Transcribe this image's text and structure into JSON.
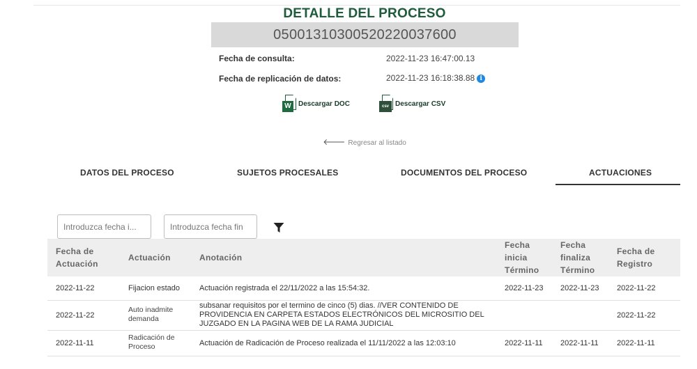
{
  "header": {
    "title": "DETALLE DEL PROCESO",
    "radicado": "05001310300520220037600",
    "consulta_label": "Fecha de consulta:",
    "consulta_value": "2022-11-23 16:47:00.13",
    "replicacion_label": "Fecha de replicación de datos:",
    "replicacion_value": "2022-11-23 16:18:38.88",
    "info_icon": "i"
  },
  "downloads": {
    "doc_badge": "W",
    "doc_label": "Descargar DOC",
    "csv_badge": "csv",
    "csv_label": "Descargar CSV"
  },
  "back_link": {
    "arrow": "🡐",
    "label": "Regresar al listado"
  },
  "tabs": [
    {
      "label": "DATOS DEL PROCESO"
    },
    {
      "label": "SUJETOS PROCESALES"
    },
    {
      "label": "DOCUMENTOS DEL PROCESO"
    },
    {
      "label": "ACTUACIONES",
      "active": true
    }
  ],
  "filters": {
    "start_placeholder": "Introduzca fecha i...",
    "end_placeholder": "Introduzca fecha fin",
    "filter_icon": "filter-icon"
  },
  "table": {
    "headers": {
      "fecha_actuacion": [
        "Fecha de",
        "Actuación"
      ],
      "actuacion": "Actuación",
      "anotacion": "Anotación",
      "fecha_inicia": [
        "Fecha",
        "inicia",
        "Término"
      ],
      "fecha_finaliza": [
        "Fecha",
        "finaliza",
        "Término"
      ],
      "fecha_registro": [
        "Fecha de",
        "Registro"
      ]
    },
    "rows": [
      {
        "fecha_actuacion": "2022-11-22",
        "actuacion": "Fijacion estado",
        "anotacion": "Actuación registrada el 22/11/2022 a las 15:54:32.",
        "fecha_inicia": "2022-11-23",
        "fecha_finaliza": "2022-11-23",
        "fecha_registro": "2022-11-22"
      },
      {
        "fecha_actuacion": "2022-11-22",
        "actuacion_lines": [
          "Auto inadmite",
          "demanda"
        ],
        "anotacion_lines": [
          "subsanar requisitos por el termino de cinco (5) dias. //VER CONTENIDO DE",
          "PROVIDENCIA EN CARPETA ESTADOS ELECTRÓNICOS DEL MICROSITIO DEL",
          "JUZGADO EN LA PAGINA WEB DE LA RAMA JUDICIAL"
        ],
        "fecha_inicia": "",
        "fecha_finaliza": "",
        "fecha_registro": "2022-11-22"
      },
      {
        "fecha_actuacion": "2022-11-11",
        "actuacion_lines": [
          "Radicación de",
          "Proceso"
        ],
        "anotacion": "Actuación de Radicación de Proceso realizada el 11/11/2022 a las 12:03:10",
        "fecha_inicia": "2022-11-11",
        "fecha_finaliza": "2022-11-11",
        "fecha_registro": "2022-11-11"
      }
    ]
  }
}
